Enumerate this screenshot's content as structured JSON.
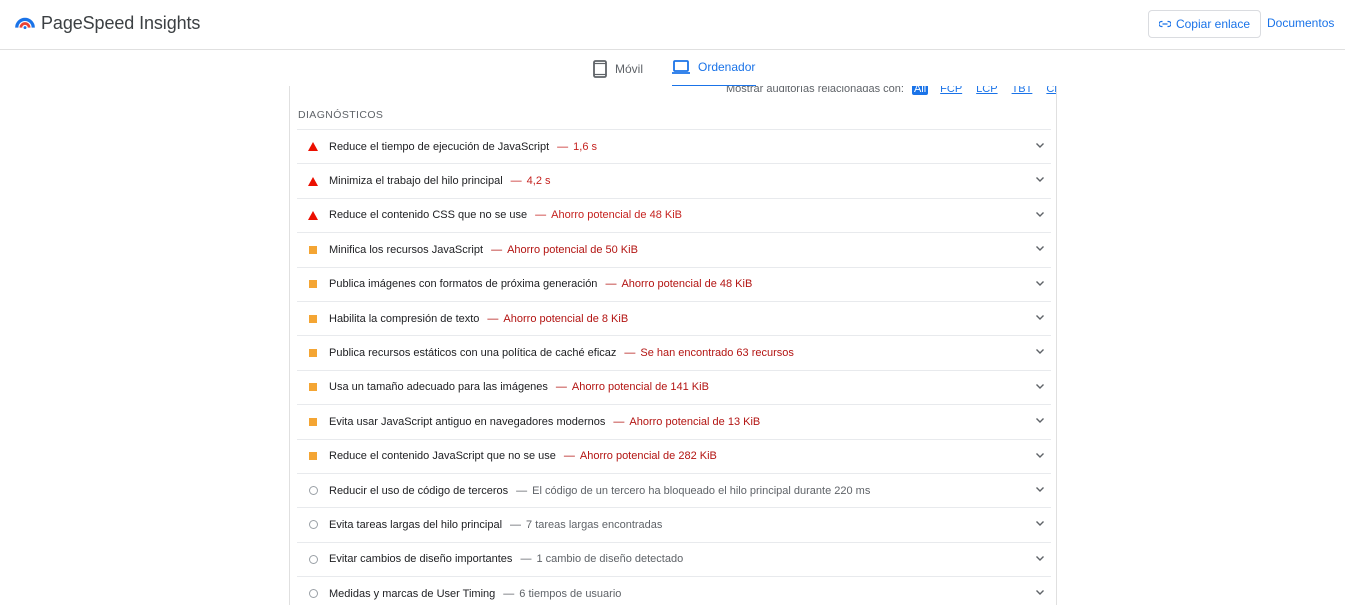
{
  "header": {
    "app_name": "PageSpeed Insights",
    "copy_link_label": "Copiar enlace",
    "docs_label": "Documentos"
  },
  "tabs": [
    {
      "label": "Móvil",
      "active": false,
      "icon": "smartphone-icon"
    },
    {
      "label": "Ordenador",
      "active": true,
      "icon": "laptop-icon"
    }
  ],
  "filter": {
    "label": "Mostrar auditorías relacionadas con:",
    "chips": [
      {
        "label": "All",
        "active": true
      },
      {
        "label": "FCP",
        "active": false
      },
      {
        "label": "LCP",
        "active": false
      },
      {
        "label": "TBT",
        "active": false
      },
      {
        "label": "CLS",
        "active": false
      }
    ]
  },
  "diagnostics": {
    "title": "DIAGNÓSTICOS",
    "items": [
      {
        "status": "fail",
        "title": "Reduce el tiempo de ejecución de JavaScript",
        "detail": "1,6 s"
      },
      {
        "status": "fail",
        "title": "Minimiza el trabajo del hilo principal",
        "detail": "4,2 s"
      },
      {
        "status": "fail",
        "title": "Reduce el contenido CSS que no se use",
        "detail": "Ahorro potencial de 48 KiB"
      },
      {
        "status": "average",
        "title": "Minifica los recursos JavaScript",
        "detail": "Ahorro potencial de 50 KiB"
      },
      {
        "status": "average",
        "title": "Publica imágenes con formatos de próxima generación",
        "detail": "Ahorro potencial de 48 KiB"
      },
      {
        "status": "average",
        "title": "Habilita la compresión de texto",
        "detail": "Ahorro potencial de 8 KiB"
      },
      {
        "status": "average",
        "title": "Publica recursos estáticos con una política de caché eficaz",
        "detail": "Se han encontrado 63 recursos"
      },
      {
        "status": "average",
        "title": "Usa un tamaño adecuado para las imágenes",
        "detail": "Ahorro potencial de 141 KiB"
      },
      {
        "status": "average",
        "title": "Evita usar JavaScript antiguo en navegadores modernos",
        "detail": "Ahorro potencial de 13 KiB"
      },
      {
        "status": "average",
        "title": "Reduce el contenido JavaScript que no se use",
        "detail": "Ahorro potencial de 282 KiB"
      },
      {
        "status": "info",
        "title": "Reducir el uso de código de terceros",
        "detail": "El código de un tercero ha bloqueado el hilo principal durante 220 ms"
      },
      {
        "status": "info",
        "title": "Evita tareas largas del hilo principal",
        "detail": "7 tareas largas encontradas"
      },
      {
        "status": "info",
        "title": "Evitar cambios de diseño importantes",
        "detail": "1 cambio de diseño detectado"
      },
      {
        "status": "info",
        "title": "Medidas y marcas de User Timing",
        "detail": "6 tiempos de usuario"
      }
    ]
  },
  "separator": "—",
  "colors": {
    "accent": "#1a73e8",
    "fail": "#eb0f00",
    "average": "#f4a533",
    "info": "#9aa0a6"
  }
}
